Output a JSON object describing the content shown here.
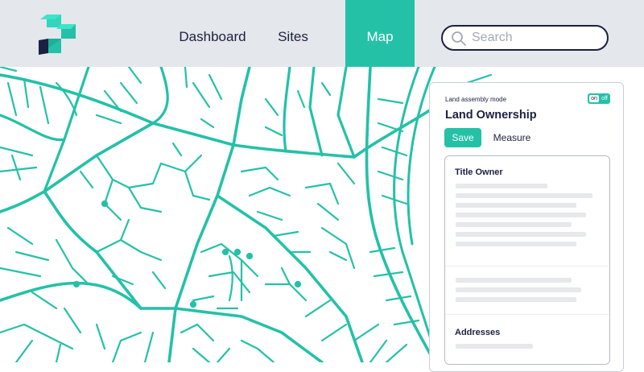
{
  "header": {
    "logo_icon": "brand-logo-icon",
    "nav": [
      {
        "label": "Dashboard",
        "active": false
      },
      {
        "label": "Sites",
        "active": false
      },
      {
        "label": "Map",
        "active": true
      }
    ],
    "search": {
      "placeholder": "Search",
      "value": "",
      "icon": "search-icon"
    }
  },
  "map": {
    "line_color": "#24c1a7",
    "background": "#ffffff"
  },
  "panel": {
    "mode_label": "Land assembly mode",
    "toggle": {
      "on_label": "on",
      "off_label": "off",
      "state": "on"
    },
    "title": "Land Ownership",
    "save_label": "Save",
    "measure_label": "Measure",
    "sections": [
      {
        "title": "Title Owner"
      },
      {
        "title": "Addresses"
      }
    ]
  },
  "colors": {
    "accent": "#24c1a7",
    "navy": "#1b2140",
    "header_bg": "#e4e7eb",
    "placeholder_bar": "#e6e8ec"
  }
}
